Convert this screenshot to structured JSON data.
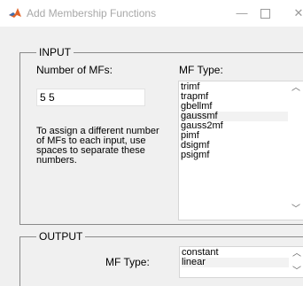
{
  "window": {
    "title": "Add Membership Functions",
    "minimize_glyph": "—",
    "close_glyph": "✕"
  },
  "input_panel": {
    "title": "INPUT",
    "num_mfs_label": "Number of MFs:",
    "num_mfs_value": "5 5",
    "help_text": "To assign a different number of MFs to each input, use spaces to separate these numbers.",
    "mf_type_label": "MF Type:",
    "mf_types": [
      "trimf",
      "trapmf",
      "gbellmf",
      "gaussmf",
      "gauss2mf",
      "pimf",
      "dsigmf",
      "psigmf"
    ],
    "selected_mf_type": "gaussmf"
  },
  "output_panel": {
    "title": "OUTPUT",
    "mf_type_label": "MF Type:",
    "mf_types": [
      "constant",
      "linear"
    ],
    "selected_mf_type": "linear"
  },
  "icons": {
    "app": "matlab-icon",
    "scroll_up": "chevron-up-icon",
    "scroll_down": "chevron-down-icon"
  },
  "colors": {
    "titlebar_bg": "#ffffff",
    "window_bg": "#f0f0f0",
    "title_text": "#a8a8a8",
    "panel_border": "#8a8a8a"
  }
}
